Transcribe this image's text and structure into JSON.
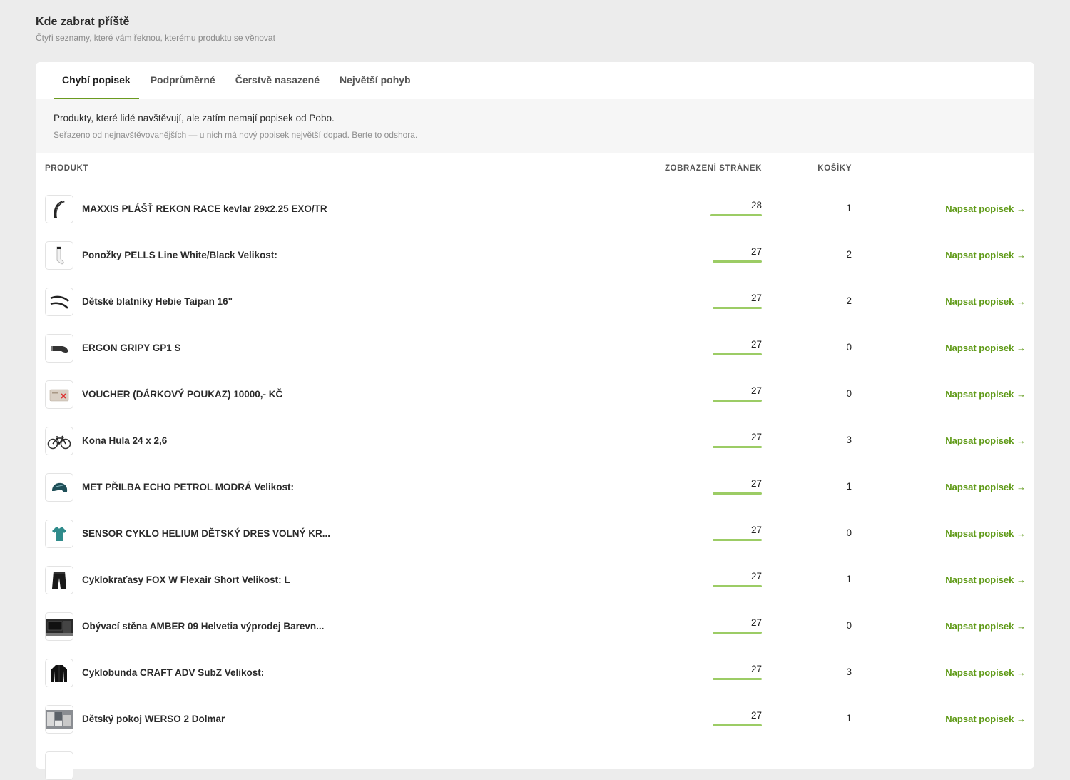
{
  "header": {
    "title": "Kde zabrat příště",
    "subtitle": "Čtyři seznamy, které vám řeknou, kterému produktu se věnovat"
  },
  "tabs": [
    {
      "label": "Chybí popisek"
    },
    {
      "label": "Podprůměrné"
    },
    {
      "label": "Čerstvě nasazené"
    },
    {
      "label": "Největší pohyb"
    }
  ],
  "info": {
    "main": "Produkty, které lidé navštěvují, ale zatím nemají popisek od Pobo.",
    "sub": "Seřazeno od nejnavštěvovanějších — u nich má nový popisek největší dopad. Berte to odshora."
  },
  "table": {
    "col_product": "PRODUKT",
    "col_views": "ZOBRAZENÍ STRÁNEK",
    "col_carts": "KOŠÍKY",
    "action_label": "Napsat popisek →",
    "max_views": 28,
    "rows": [
      {
        "name": "MAXXIS PLÁŠŤ REKON RACE kevlar 29x2.25 EXO/TR",
        "views": "28",
        "carts": "1",
        "icon": "tire-icon"
      },
      {
        "name": "Ponožky PELLS Line White/Black Velikost:",
        "views": "27",
        "carts": "2",
        "icon": "sock-icon"
      },
      {
        "name": "Dětské blatníky Hebie Taipan 16\"",
        "views": "27",
        "carts": "2",
        "icon": "fender-icon"
      },
      {
        "name": "ERGON GRIPY GP1 S",
        "views": "27",
        "carts": "0",
        "icon": "grip-icon"
      },
      {
        "name": "VOUCHER (DÁRKOVÝ POUKAZ) 10000,- KČ",
        "views": "27",
        "carts": "0",
        "icon": "voucher-icon"
      },
      {
        "name": "Kona Hula 24 x 2,6",
        "views": "27",
        "carts": "3",
        "icon": "bike-icon"
      },
      {
        "name": "MET PŘILBA ECHO PETROL MODRÁ Velikost:",
        "views": "27",
        "carts": "1",
        "icon": "helmet-icon"
      },
      {
        "name": "SENSOR CYKLO HELIUM DĚTSKÝ DRES VOLNÝ KR...",
        "views": "27",
        "carts": "0",
        "icon": "jersey-icon"
      },
      {
        "name": "Cyklokraťasy FOX W Flexair Short Velikost: L",
        "views": "27",
        "carts": "1",
        "icon": "shorts-icon"
      },
      {
        "name": "Obývací stěna AMBER 09 Helvetia výprodej Barevn...",
        "views": "27",
        "carts": "0",
        "icon": "tv-wall-icon"
      },
      {
        "name": "Cyklobunda CRAFT ADV SubZ Velikost:",
        "views": "27",
        "carts": "3",
        "icon": "jacket-icon"
      },
      {
        "name": "Dětský pokoj WERSO 2 Dolmar",
        "views": "27",
        "carts": "1",
        "icon": "room-icon"
      }
    ]
  }
}
